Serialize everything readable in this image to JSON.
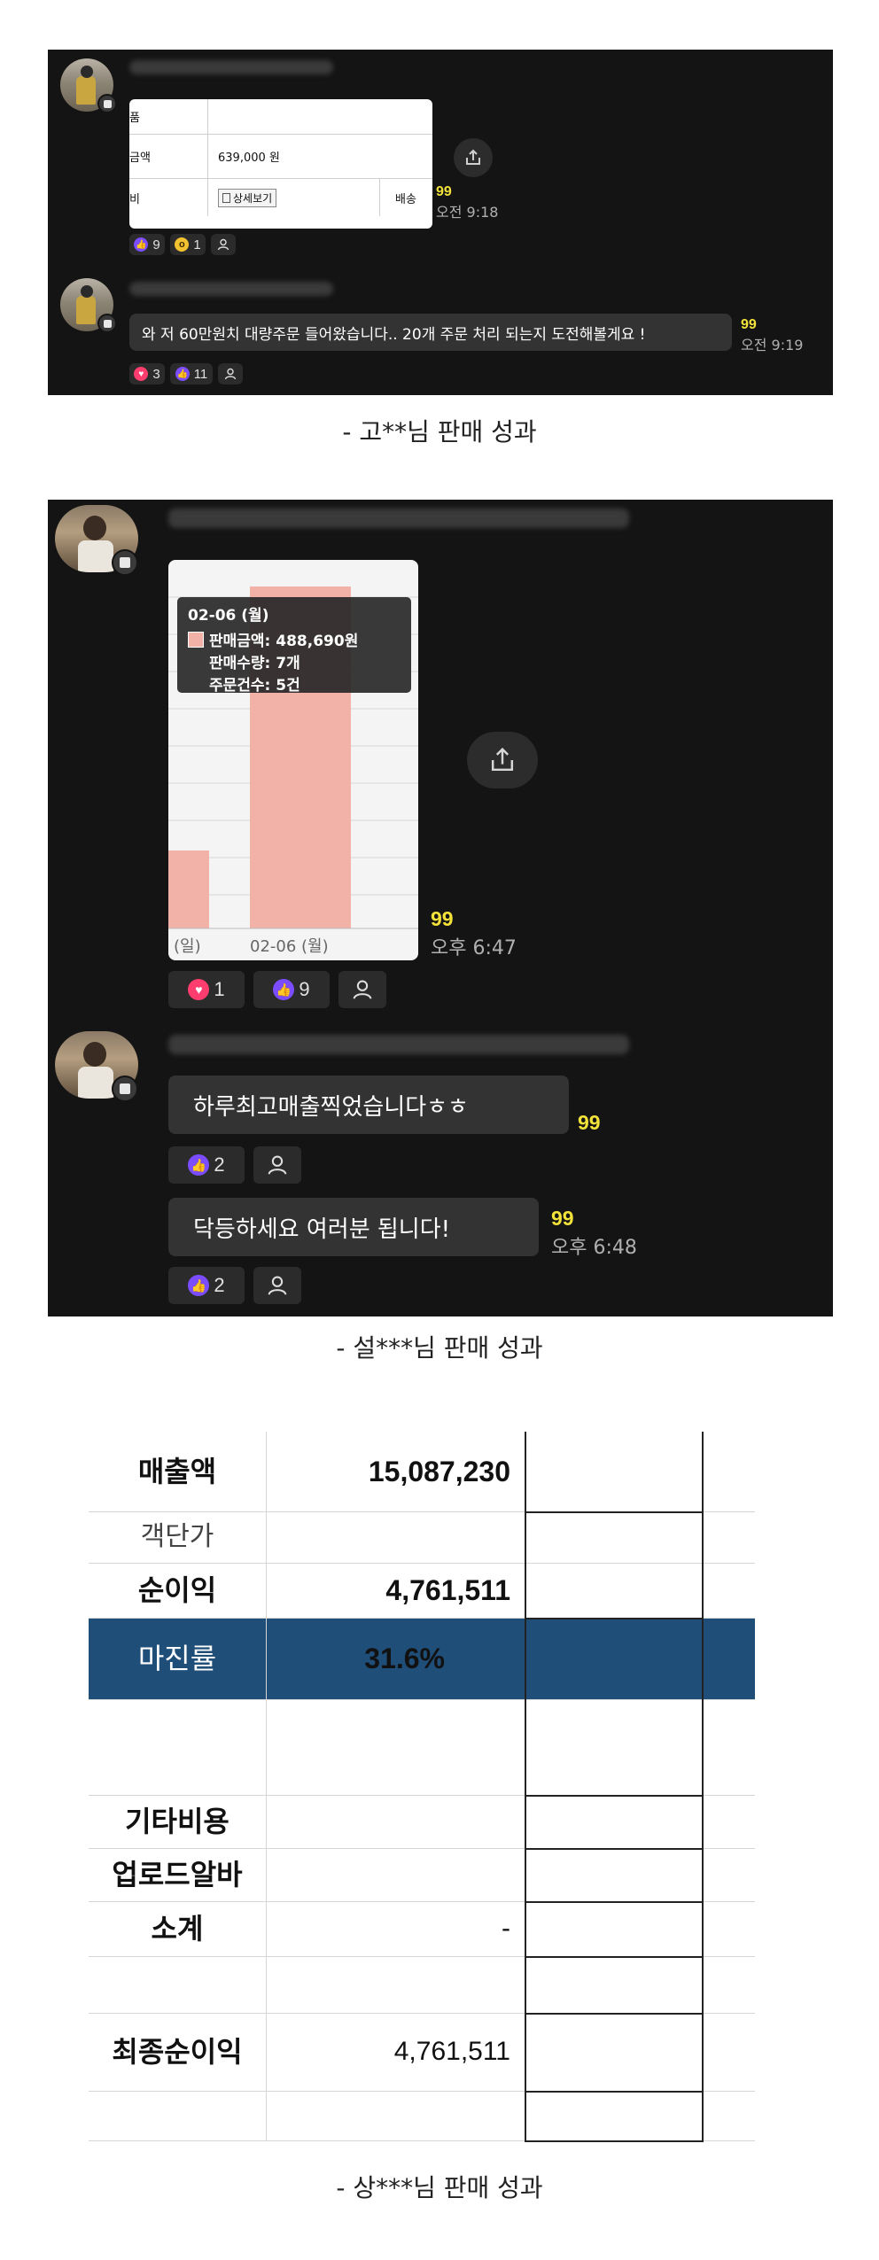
{
  "panel1": {
    "card": {
      "row1_label": "품",
      "row2_label": "금액",
      "row2_value": "639,000 원",
      "row3_label": "비",
      "detail_button": "상세보기",
      "row3_right": "배송"
    },
    "msg1": {
      "count": "99",
      "time": "오전 9:18",
      "reactions": [
        {
          "icon": "thumbs-up",
          "count": "9"
        },
        {
          "icon": "wow",
          "count": "1"
        }
      ]
    },
    "msg2": {
      "text": "와 저 60만원치 대량주문 들어왔습니다.. 20개 주문 처리 되는지 도전해볼게요 !",
      "count": "99",
      "time": "오전 9:19",
      "reactions": [
        {
          "icon": "heart",
          "count": "3"
        },
        {
          "icon": "thumbs-up",
          "count": "11"
        }
      ]
    },
    "caption": "- 고**님 판매 성과"
  },
  "panel2": {
    "chart": {
      "tooltip_date": "02-06 (월)",
      "tooltip_lines": [
        "판매금액: 488,690원",
        "판매수량: 7개",
        "주문건수: 5건"
      ],
      "xlabels": [
        "(일)",
        "02-06 (월)"
      ]
    },
    "msg1": {
      "count": "99",
      "time": "오후 6:47",
      "reactions": [
        {
          "icon": "heart",
          "count": "1"
        },
        {
          "icon": "thumbs-up",
          "count": "9"
        }
      ]
    },
    "msg2": {
      "text": "하루최고매출찍었습니다ㅎㅎ",
      "count": "99",
      "reactions": [
        {
          "icon": "thumbs-up",
          "count": "2"
        }
      ]
    },
    "msg3": {
      "text": "닥등하세요 여러분 됩니다!",
      "count": "99",
      "time": "오후 6:48",
      "reactions": [
        {
          "icon": "thumbs-up",
          "count": "2"
        }
      ]
    },
    "caption": "- 설***님 판매 성과"
  },
  "sheet": {
    "rows": [
      {
        "label": "매출액",
        "value": "15,087,230"
      },
      {
        "label": "객단가",
        "value": ""
      },
      {
        "label": "순이익",
        "value": "4,761,511"
      },
      {
        "label": "마진률",
        "value": "31.6%"
      },
      {
        "label": "",
        "value": ""
      },
      {
        "label": "기타비용",
        "value": ""
      },
      {
        "label": "업로드알바",
        "value": ""
      },
      {
        "label": "소계",
        "value": "-"
      },
      {
        "label": "",
        "value": ""
      },
      {
        "label": "최종순이익",
        "value": "4,761,511"
      }
    ],
    "highlight_color": "#1f4e79",
    "caption": "- 상***님 판매 성과"
  },
  "colors": {
    "panel_bg": "#141414",
    "bubble_bg": "#333333",
    "count_yellow": "#f2e23a",
    "thumbs_purple": "#7b4dff",
    "heart_pink": "#ff3d6e",
    "bar_salmon": "#f2b2a8"
  }
}
